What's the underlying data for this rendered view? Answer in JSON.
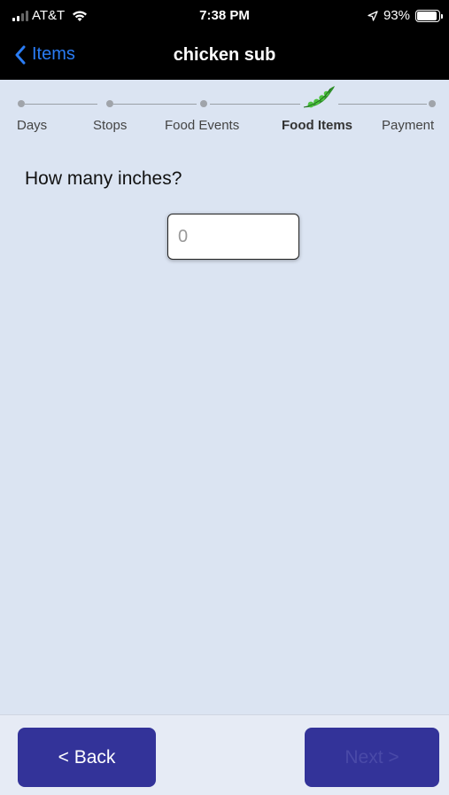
{
  "status_bar": {
    "carrier": "AT&T",
    "time": "7:38 PM",
    "battery": "93%",
    "battery_level": 0.93
  },
  "nav": {
    "back_label": "Items",
    "title": "chicken sub"
  },
  "stepper": {
    "steps": [
      {
        "label": "Days",
        "active": false
      },
      {
        "label": "Stops",
        "active": false
      },
      {
        "label": "Food Events",
        "active": false
      },
      {
        "label": "Food Items",
        "active": true
      },
      {
        "label": "Payment",
        "active": false
      }
    ],
    "current_icon": "pea-pod-icon"
  },
  "form": {
    "question": "How many inches?",
    "inches_placeholder": "0",
    "inches_value": ""
  },
  "footer": {
    "back_label": "< Back",
    "next_label": "Next >",
    "next_enabled": false
  },
  "colors": {
    "background": "#dbe4f2",
    "nav_bar": "#000000",
    "link_blue": "#2a7cf4",
    "button": "#333399",
    "pea_green": "#3aa832"
  }
}
